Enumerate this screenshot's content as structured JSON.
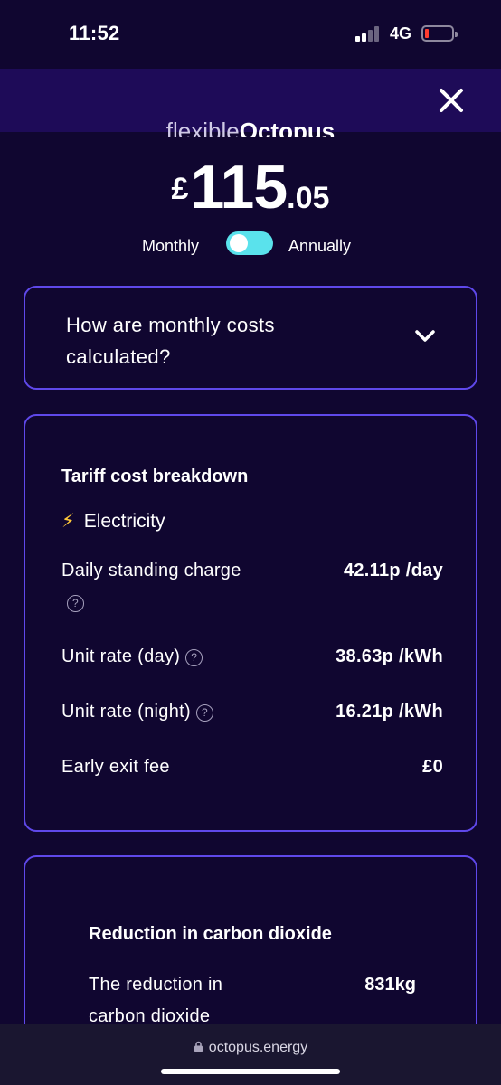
{
  "status_bar": {
    "time": "11:52",
    "network": "4G",
    "battery_level": 0.1,
    "battery_color": "#ff3b30"
  },
  "header": {
    "close_icon": "close-icon",
    "brand_prefix": "flexible",
    "brand_name": "Octopus"
  },
  "price": {
    "currency": "£",
    "integer": "115",
    "decimal": ".05"
  },
  "billing_toggle": {
    "left_label": "Monthly",
    "right_label": "Annually",
    "accent": "#5ae2ec"
  },
  "accordion": {
    "title": "How are monthly costs calculated?",
    "icon": "chevron-down-icon"
  },
  "tariff": {
    "title": "Tariff cost breakdown",
    "fuel_icon": "lightning-icon",
    "fuel_label": "Electricity",
    "rows": [
      {
        "label": "Daily standing charge",
        "value": "42.11p /day",
        "info": true
      },
      {
        "label": "Unit rate (day)",
        "value": "38.63p /kWh",
        "info": true
      },
      {
        "label": "Unit rate (night)",
        "value": "16.21p /kWh",
        "info": true
      },
      {
        "label": "Early exit fee",
        "value": "£0",
        "info": false
      }
    ]
  },
  "carbon": {
    "title": "Reduction in carbon dioxide",
    "label": "The reduction in carbon dioxide",
    "value": "831kg"
  },
  "browser": {
    "url": "octopus.energy"
  },
  "colors": {
    "background": "#100630",
    "header": "#1e0b58",
    "card_border": "#5f48ea"
  }
}
